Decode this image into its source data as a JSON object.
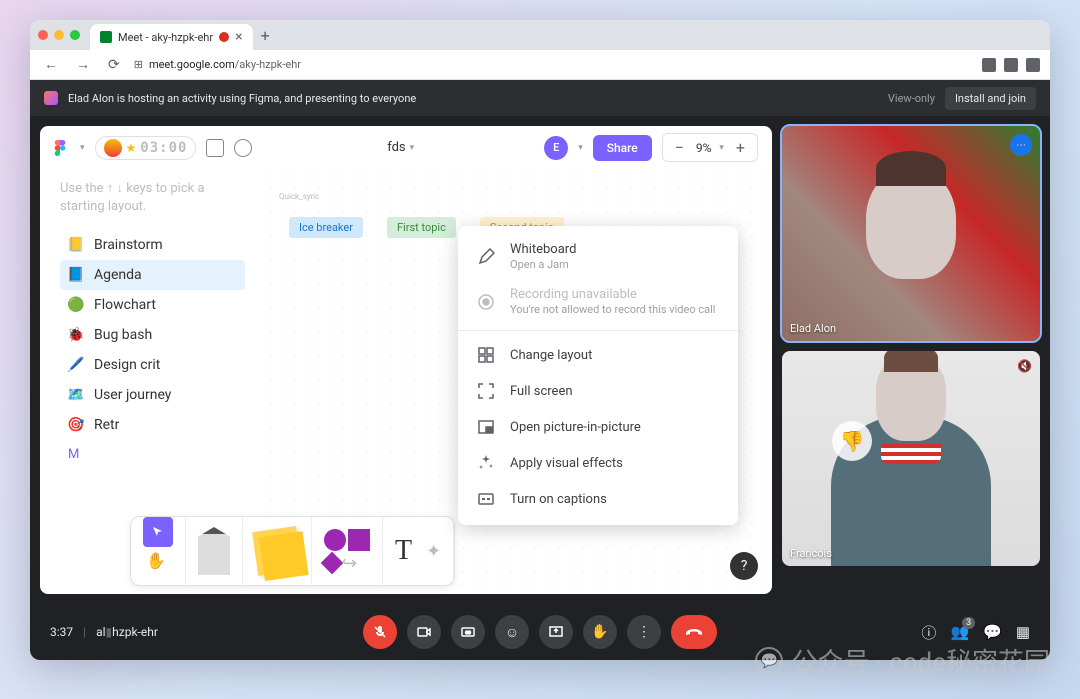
{
  "browser": {
    "tab_title": "Meet - aky-hzpk-ehr",
    "url_host": "meet.google.com",
    "url_path": "/aky-hzpk-ehr"
  },
  "banner": {
    "text": "Elad Alon is hosting an activity using Figma, and presenting to everyone",
    "view_only": "View-only",
    "install": "Install and join"
  },
  "figma": {
    "timer": "03:00",
    "doc_name": "fds",
    "avatar_letter": "E",
    "share": "Share",
    "zoom": "9%",
    "hint": "Use the ↑ ↓ keys to pick a starting layout.",
    "canvas_label": "Quick_sync",
    "templates": [
      {
        "icon": "📒",
        "label": "Brainstorm"
      },
      {
        "icon": "📘",
        "label": "Agenda"
      },
      {
        "icon": "🟢",
        "label": "Flowchart"
      },
      {
        "icon": "🐞",
        "label": "Bug bash"
      },
      {
        "icon": "🖊️",
        "label": "Design crit"
      },
      {
        "icon": "🗺️",
        "label": "User journey"
      },
      {
        "icon": "🎯",
        "label": "Retr"
      }
    ],
    "more": "M",
    "tags": [
      "Ice breaker",
      "First topic",
      "Second topic"
    ]
  },
  "context_menu": {
    "whiteboard_title": "Whiteboard",
    "whiteboard_sub": "Open a Jam",
    "recording_title": "Recording unavailable",
    "recording_sub": "You're not allowed to record this video call",
    "change_layout": "Change layout",
    "full_screen": "Full screen",
    "pip": "Open picture-in-picture",
    "visual_effects": "Apply visual effects",
    "captions": "Turn on captions"
  },
  "participants": [
    {
      "name": "Elad Alon"
    },
    {
      "name": "Francois"
    }
  ],
  "footer": {
    "time": "3:37",
    "sep": "|",
    "code_prefix": "al",
    "code_suffix": "hzpk-ehr",
    "count": "3"
  },
  "watermark": "公众号 · code秘密花园"
}
